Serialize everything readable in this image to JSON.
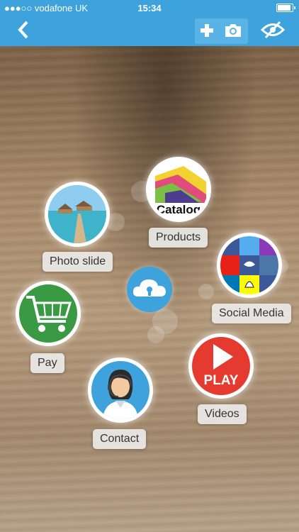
{
  "status": {
    "carrier": "●●●○○ vodafone UK",
    "time": "15:34",
    "battery_level": 0.9
  },
  "nav": {
    "back_icon": "chevron-left-icon",
    "add_icon": "plus-icon",
    "camera_icon": "camera-icon",
    "eye_icon": "eye-slash-icon"
  },
  "catalog_logo_text": "Catalog",
  "items": [
    {
      "label": "Products",
      "icon": "catalog-icon"
    },
    {
      "label": "Photo slide",
      "icon": "photo-slide-icon"
    },
    {
      "label": "Social Media",
      "icon": "social-media-icon"
    },
    {
      "label": "Pay",
      "icon": "shopping-cart-icon"
    },
    {
      "label": "Videos",
      "icon": "play-icon"
    },
    {
      "label": "Contact",
      "icon": "contact-agent-icon"
    }
  ],
  "play_text": "PLAY",
  "center_icon": "cloud-lock-icon",
  "colors": {
    "accent": "#3ea2dc",
    "pay_green": "#3a9a44",
    "play_red": "#e53a2f"
  }
}
